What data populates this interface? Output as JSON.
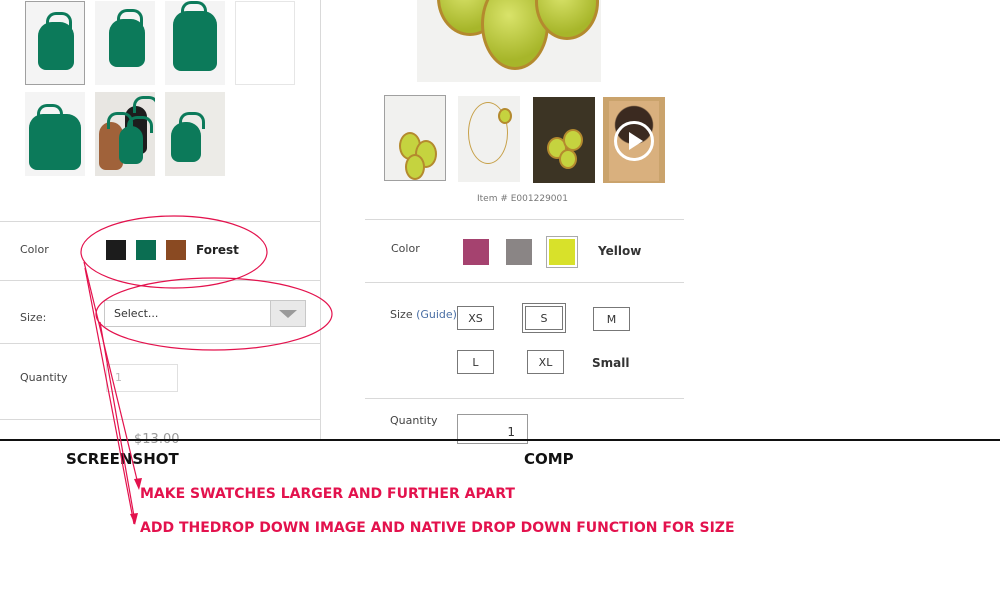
{
  "screenshot": {
    "color_label": "Color",
    "swatches": [
      {
        "name": "black",
        "color": "#1c1c1c"
      },
      {
        "name": "forest",
        "color": "#0b6e52"
      },
      {
        "name": "brown",
        "color": "#8a4a22"
      }
    ],
    "selected_color": "Forest",
    "size_label": "Size:",
    "size_placeholder": "Select...",
    "quantity_label": "Quantity",
    "quantity_value": "1",
    "price_partial": "$13.00"
  },
  "comp": {
    "item_number": "Item # E001229001",
    "color_label": "Color",
    "swatches": [
      {
        "name": "magenta",
        "color": "#a5426f"
      },
      {
        "name": "gray",
        "color": "#8a8585"
      },
      {
        "name": "yellow",
        "color": "#d8e12a"
      }
    ],
    "selected_color": "Yellow",
    "size_label": "Size",
    "guide_link": "(Guide)",
    "sizes": [
      "XS",
      "S",
      "M",
      "L",
      "XL"
    ],
    "selected_size_label": "Small",
    "quantity_label": "Quantity",
    "quantity_value": "1"
  },
  "annotations": {
    "screenshot_caption": "SCREENSHOT",
    "comp_caption": "COMP",
    "note_1": "MAKE SWATCHES LARGER AND FURTHER APART",
    "note_2": "ADD THEDROP DOWN IMAGE AND NATIVE DROP DOWN FUNCTION FOR SIZE",
    "accent_color": "#e3124d"
  }
}
